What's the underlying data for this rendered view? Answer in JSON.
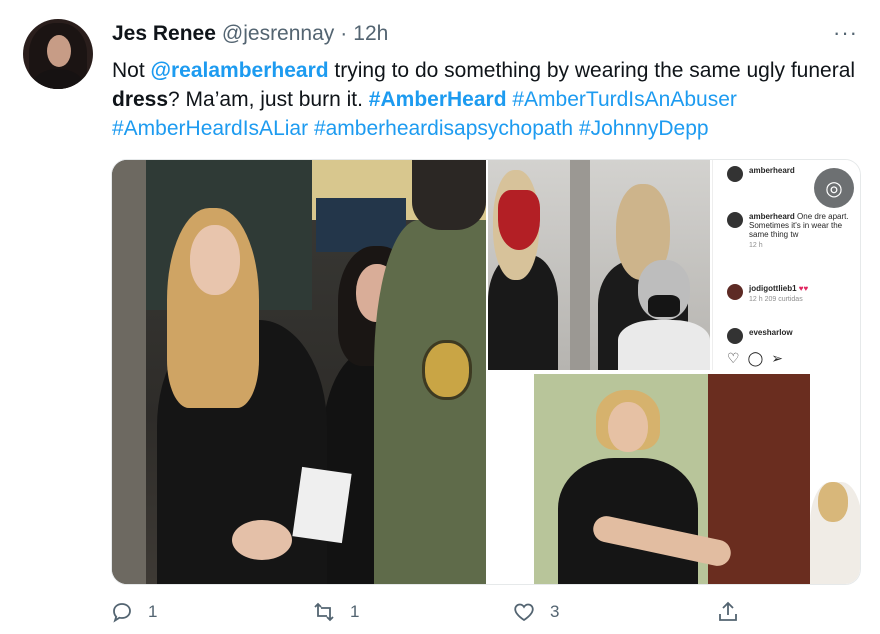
{
  "tweet": {
    "author": {
      "name": "Jes Renee",
      "handle": "@jesrennay",
      "separator": "·",
      "time": "12h"
    },
    "more_label": "···",
    "text": {
      "t1": "Not ",
      "mention": "@realamberheard",
      "t2": " trying to do something by wearing the same ugly funeral ",
      "bold": "dress",
      "t3": "? Ma’am, just burn it. ",
      "hashtags": [
        "#AmberHeard",
        "#AmberTurdIsAnAbuser",
        "#AmberHeardIsALiar",
        "#amberheardisapsychopath",
        "#JohnnyDepp"
      ]
    },
    "instagram": {
      "header_name": "amberheard",
      "post_name": "amberheard",
      "post_text": "One dre apart. Sometimes it's in wear the same thing tw",
      "post_time": "12 h",
      "comment_name": "jodigottlieb1",
      "comment_hearts": "♥♥",
      "comment_meta": "12 h   209 curtidas",
      "next_name": "evesharlow"
    },
    "actions": {
      "reply_count": "1",
      "retweet_count": "1",
      "like_count": "3"
    }
  },
  "colors": {
    "link": "#1d9bf0",
    "secondary": "#536471",
    "text": "#0f1419"
  },
  "icons": {
    "reply": "reply-icon",
    "retweet": "retweet-icon",
    "like": "heart-icon",
    "share": "share-icon",
    "lens": "google-lens-icon"
  }
}
